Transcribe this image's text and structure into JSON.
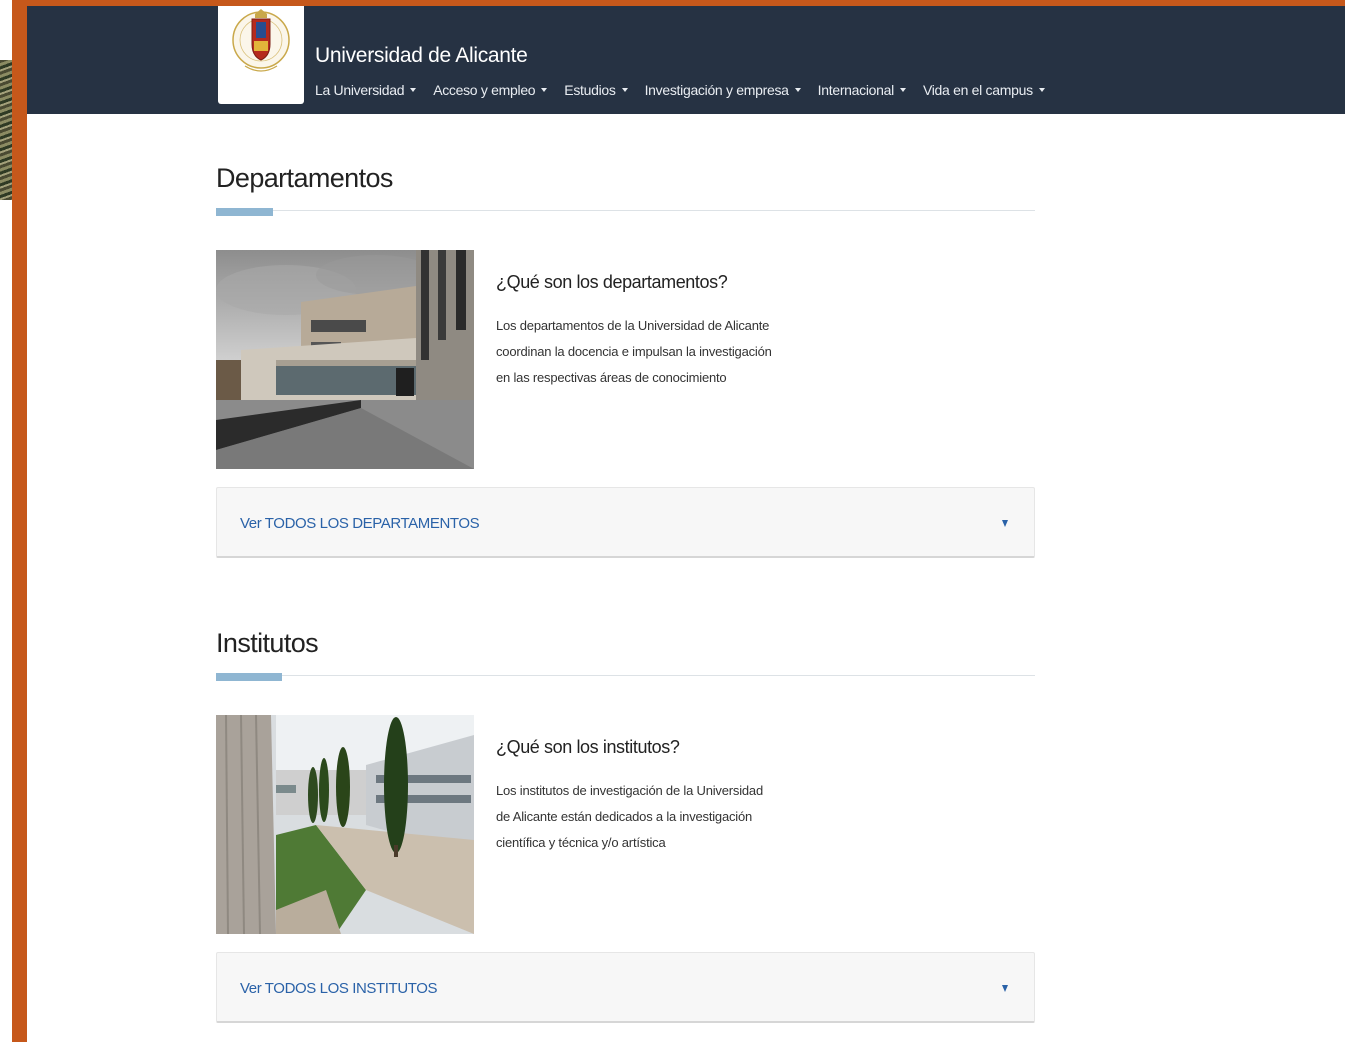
{
  "header": {
    "site_title": "Universidad de Alicante",
    "logo_icon": "university-seal-icon",
    "nav": [
      {
        "label": "La Universidad"
      },
      {
        "label": "Acceso y empleo"
      },
      {
        "label": "Estudios"
      },
      {
        "label": "Investigación y empresa"
      },
      {
        "label": "Internacional"
      },
      {
        "label": "Vida en el campus"
      }
    ]
  },
  "colors": {
    "header_bg": "#263243",
    "accent_orange": "#c6581b",
    "section_rule_accent": "#8fb6d2",
    "link_blue": "#2a62a8"
  },
  "departamentos": {
    "title": "Departamentos",
    "heading": "¿Qué son los departamentos?",
    "body_lines": [
      "Los departamentos de la Universidad de Alicante",
      "coordinan la docencia e impulsan la investigación",
      "en las respectivas áreas de conocimiento"
    ],
    "accordion_label": "Ver TODOS LOS DEPARTAMENTOS"
  },
  "institutos": {
    "title": "Institutos",
    "heading": "¿Qué son los institutos?",
    "body_lines": [
      "Los institutos de investigación de la Universidad",
      "de Alicante están dedicados a la investigación",
      "científica y técnica y/o artística"
    ],
    "accordion_label": "Ver TODOS LOS INSTITUTOS"
  }
}
